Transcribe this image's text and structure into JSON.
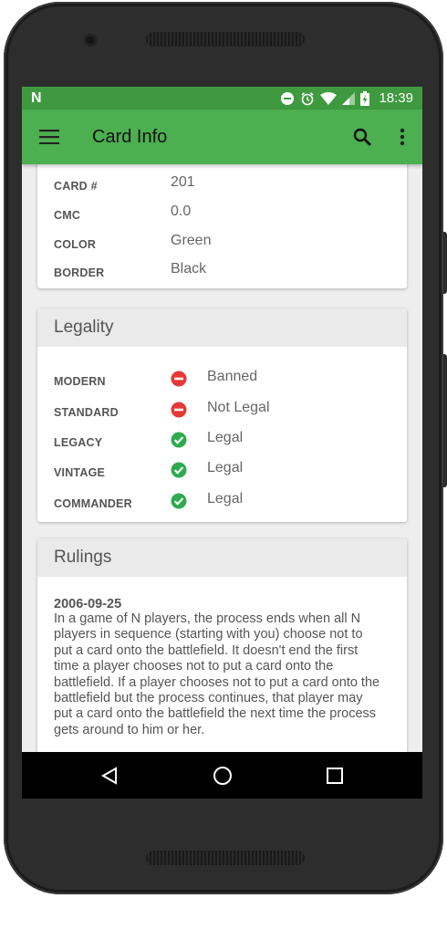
{
  "status_bar": {
    "carrier_logo": "N",
    "time": "18:39",
    "icons": [
      "do-not-disturb-icon",
      "alarm-icon",
      "wifi-icon",
      "signal-icon",
      "battery-charging-icon"
    ]
  },
  "app_bar": {
    "title": "Card Info",
    "icons": [
      "menu-icon",
      "search-icon",
      "overflow-menu-icon"
    ]
  },
  "card_details": {
    "rows": [
      {
        "label": "CARD #",
        "value": "201"
      },
      {
        "label": "CMC",
        "value": "0.0"
      },
      {
        "label": "COLOR",
        "value": "Green"
      },
      {
        "label": "BORDER",
        "value": "Black"
      }
    ]
  },
  "legality": {
    "title": "Legality",
    "rows": [
      {
        "label": "MODERN",
        "status": "Banned",
        "icon": "banned-icon"
      },
      {
        "label": "STANDARD",
        "status": "Not Legal",
        "icon": "banned-icon"
      },
      {
        "label": "LEGACY",
        "status": "Legal",
        "icon": "check-circle-icon"
      },
      {
        "label": "VINTAGE",
        "status": "Legal",
        "icon": "check-circle-icon"
      },
      {
        "label": "COMMANDER",
        "status": "Legal",
        "icon": "check-circle-icon"
      }
    ]
  },
  "rulings": {
    "title": "Rulings",
    "items": [
      {
        "date": "2006-09-25",
        "text": "In a game of N players, the process ends when all N players in sequence (starting with you) choose not to put a card onto the battlefield. It doesn't end the first time a player chooses not to put a card onto the battlefield. If a player chooses not to put a card onto the battlefield but the process continues, that player may put a card onto the battlefield the next time the process gets around to him or her."
      }
    ]
  },
  "nav_bar": {
    "icons": [
      "back-icon",
      "home-icon",
      "recents-icon"
    ]
  },
  "colors": {
    "app_bar": "#4caf50",
    "status_bar": "#3f9a3f",
    "banned": "#e53935",
    "legal": "#2eaa4f"
  }
}
